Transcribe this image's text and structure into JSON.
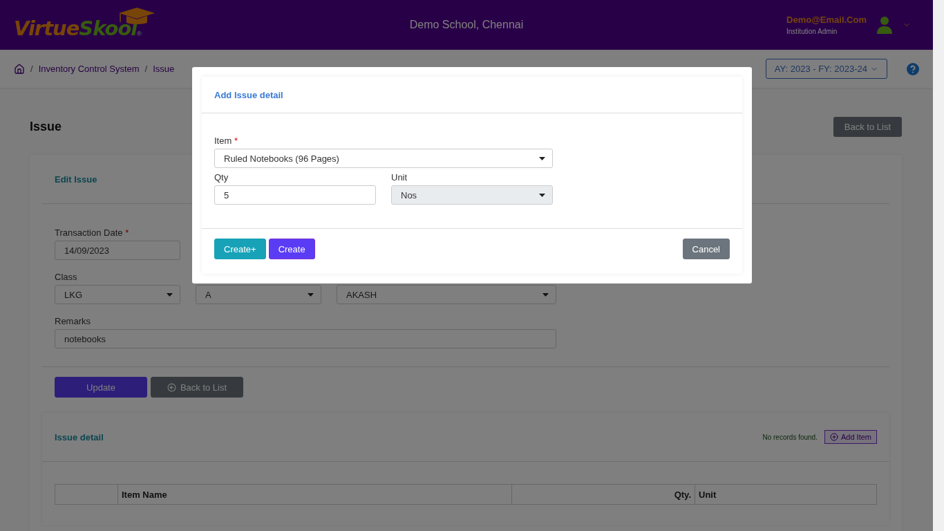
{
  "header": {
    "logo": {
      "first": "Virtue",
      "second": "Skool",
      "mark": "®"
    },
    "school": "Demo School, Chennai",
    "user": {
      "email": "Demo@Email.Com",
      "role": "Institution Admin"
    }
  },
  "breadcrumb": [
    {
      "separator": "/",
      "label": "Inventory Control System"
    },
    {
      "separator": "/",
      "label": "Issue"
    }
  ],
  "academic_year": "AY: 2023 - FY: 2023-24",
  "page": {
    "title": "Issue",
    "back_button": "Back to List"
  },
  "edit_card": {
    "title": "Edit Issue",
    "rows": [
      [
        {
          "kind": "text",
          "label": "Transaction Date",
          "required_mark": "*",
          "value": "14/09/2023"
        }
      ],
      [
        {
          "kind": "select",
          "label": "Class",
          "value": "LKG"
        },
        {
          "kind": "select",
          "value": "A"
        },
        {
          "kind": "select",
          "value": "AKASH"
        }
      ],
      [
        {
          "kind": "text",
          "label": "Remarks",
          "value": "notebooks"
        }
      ]
    ],
    "buttons": [
      {
        "kind": "primary",
        "label": "Update"
      },
      {
        "kind": "back",
        "label": "Back to List"
      }
    ]
  },
  "detail_card": {
    "title": "Issue detail",
    "message": "No records found.",
    "add_button": "Add Item",
    "table": {
      "columns": [
        "Item Name",
        "Qty.",
        "Unit"
      ]
    }
  },
  "modal": {
    "title": "Add Issue detail",
    "rows": [
      [
        {
          "kind": "select",
          "label": "Item",
          "required_mark": "*",
          "value": "Ruled Notebooks (96 Pages)",
          "disabled": false
        }
      ],
      [
        {
          "kind": "text",
          "label": "Qty",
          "value": "5",
          "disabled": false
        },
        {
          "kind": "select",
          "label": "Unit",
          "value": "Nos",
          "disabled": true
        }
      ]
    ],
    "buttons": [
      {
        "kind": "info",
        "label": "Create+"
      },
      {
        "kind": "primary",
        "label": "Create"
      },
      {
        "kind": "secondary",
        "label": "Cancel"
      }
    ]
  }
}
